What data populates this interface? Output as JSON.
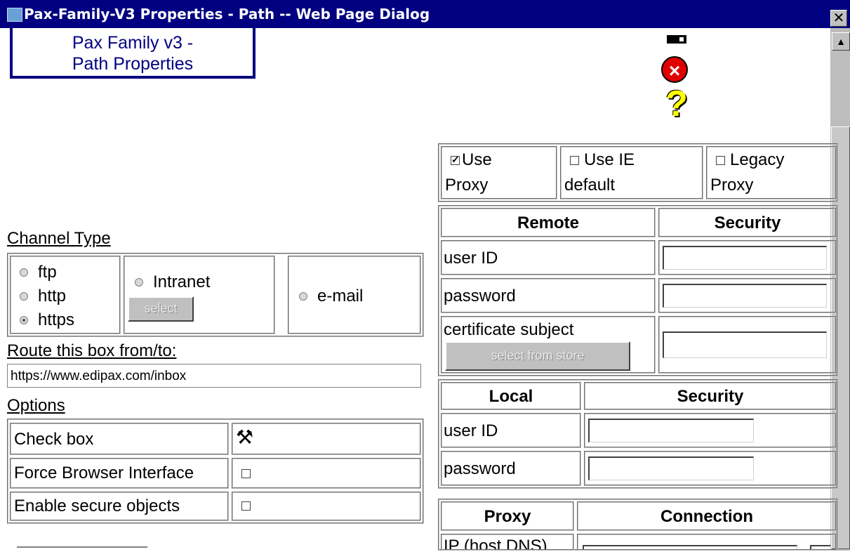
{
  "window": {
    "title": "Pax-Family-V3 Properties - Path -- Web Page Dialog",
    "close_glyph": "✕"
  },
  "header": {
    "logo_line1": "Pax Family v3 -",
    "logo_line2": "Path Properties"
  },
  "toolbar_icons": [
    "minimize-icon",
    "close-circle-icon",
    "help-question-icon"
  ],
  "channel": {
    "label": "Channel Type",
    "options": [
      "ftp",
      "http",
      "https"
    ],
    "selected": "https",
    "intranet_label": "Intranet",
    "select_button": "select",
    "email_label": "e-mail"
  },
  "route": {
    "label": "Route this box from/to:",
    "value": "https://www.edipax.com/inbox"
  },
  "options": {
    "label": "Options",
    "rows": [
      {
        "label": "Check box",
        "icon": "tools-icon"
      },
      {
        "label": "Force Browser Interface",
        "checked": false
      },
      {
        "label": "Enable secure objects",
        "checked": false
      }
    ]
  },
  "proxy_checks": {
    "use_proxy_line1": "Use",
    "use_proxy_line2": "Proxy",
    "use_proxy_checked": true,
    "use_ie_line1": "Use IE",
    "use_ie_line2": "default",
    "legacy_line1": "Legacy",
    "legacy_line2": "Proxy"
  },
  "remote": {
    "header_left": "Remote",
    "header_right": "Security",
    "user_id_label": "user ID",
    "password_label": "password",
    "cert_label": "certificate subject",
    "cert_button": "select from store"
  },
  "local": {
    "header_left": "Local",
    "header_right": "Security",
    "user_id_label": "user ID",
    "password_label": "password"
  },
  "proxy_conn": {
    "header_left": "Proxy",
    "header_right": "Connection",
    "ip_label": "IP (host DNS)"
  }
}
